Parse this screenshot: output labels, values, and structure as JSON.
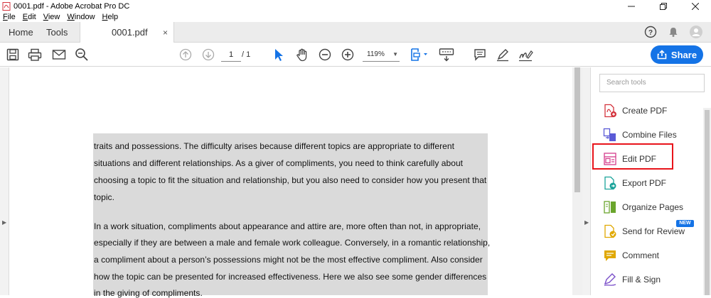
{
  "window": {
    "title": "0001.pdf - Adobe Acrobat Pro DC",
    "controls": [
      "minimize",
      "restore",
      "close"
    ]
  },
  "menu": {
    "items": [
      {
        "label": "File",
        "accel": "F"
      },
      {
        "label": "Edit",
        "accel": "E"
      },
      {
        "label": "View",
        "accel": "V"
      },
      {
        "label": "Window",
        "accel": "W"
      },
      {
        "label": "Help",
        "accel": "H"
      }
    ]
  },
  "tabs": {
    "home": "Home",
    "tools": "Tools",
    "document": "0001.pdf",
    "close_glyph": "×"
  },
  "toolbar": {
    "current_page": "1",
    "total_pages": "/ 1",
    "zoom": "119%",
    "share_label": "Share"
  },
  "document": {
    "lines": [
      "traits and possessions. The difficulty arises because different topics are appropriate to different",
      "situations and different relationships. As a giver of compliments, you need to think carefully about",
      "choosing a topic to fit the situation and relationship, but you also need to consider how you present that",
      "topic.",
      "In a work situation, compliments about appearance and attire are, more often than not, in appropriate,",
      "especially if they are between a male and female work colleague. Conversely, in a romantic relationship,",
      "a compliment about a person’s possessions might not be the most effective compliment. Also consider",
      "how the topic can be presented for increased effectiveness. Here we also see some gender differences",
      "in the giving of compliments."
    ]
  },
  "tools_pane": {
    "search_placeholder": "Search tools",
    "items": [
      {
        "label": "Create PDF",
        "icon": "create-pdf-icon",
        "color": "#d4323c"
      },
      {
        "label": "Combine Files",
        "icon": "combine-files-icon",
        "color": "#5a5ad6"
      },
      {
        "label": "Edit PDF",
        "icon": "edit-pdf-icon",
        "color": "#d43c8c"
      },
      {
        "label": "Export PDF",
        "icon": "export-pdf-icon",
        "color": "#1aa39a"
      },
      {
        "label": "Organize Pages",
        "icon": "organize-pages-icon",
        "color": "#6aa52c"
      },
      {
        "label": "Send for Review",
        "icon": "send-for-review-icon",
        "color": "#e0a800"
      },
      {
        "label": "Comment",
        "icon": "comment-icon",
        "color": "#e0a800"
      },
      {
        "label": "Fill & Sign",
        "icon": "fill-sign-icon",
        "color": "#7a4fc9"
      }
    ],
    "new_badge": "NEW"
  },
  "colors": {
    "accent": "#1473e6",
    "highlight": "#e8141b",
    "selection": "#dadada"
  }
}
